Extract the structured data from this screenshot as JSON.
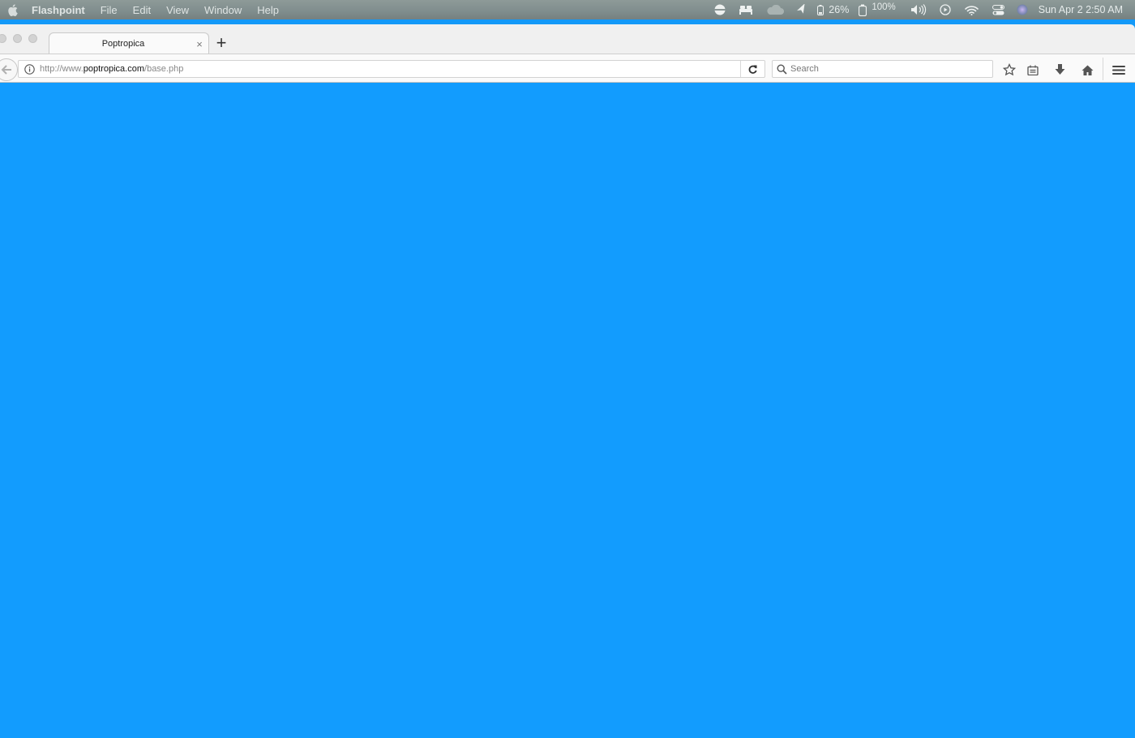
{
  "menubar": {
    "apple_icon": "apple-icon",
    "app_name": "Flashpoint",
    "menus": [
      "File",
      "Edit",
      "View",
      "Window",
      "Help"
    ],
    "status": {
      "battery_percent": "26%",
      "second_battery_percent": "100%",
      "datetime": "Sun Apr 2  2:50 AM"
    }
  },
  "browser": {
    "tab": {
      "title": "Poptropica",
      "close_label": "×"
    },
    "new_tab_label": "+",
    "url": {
      "prefix": "http://www.",
      "domain": "poptropica.com",
      "path": "/base.php"
    },
    "search_placeholder": "Search",
    "content_color": "#129cfe"
  }
}
